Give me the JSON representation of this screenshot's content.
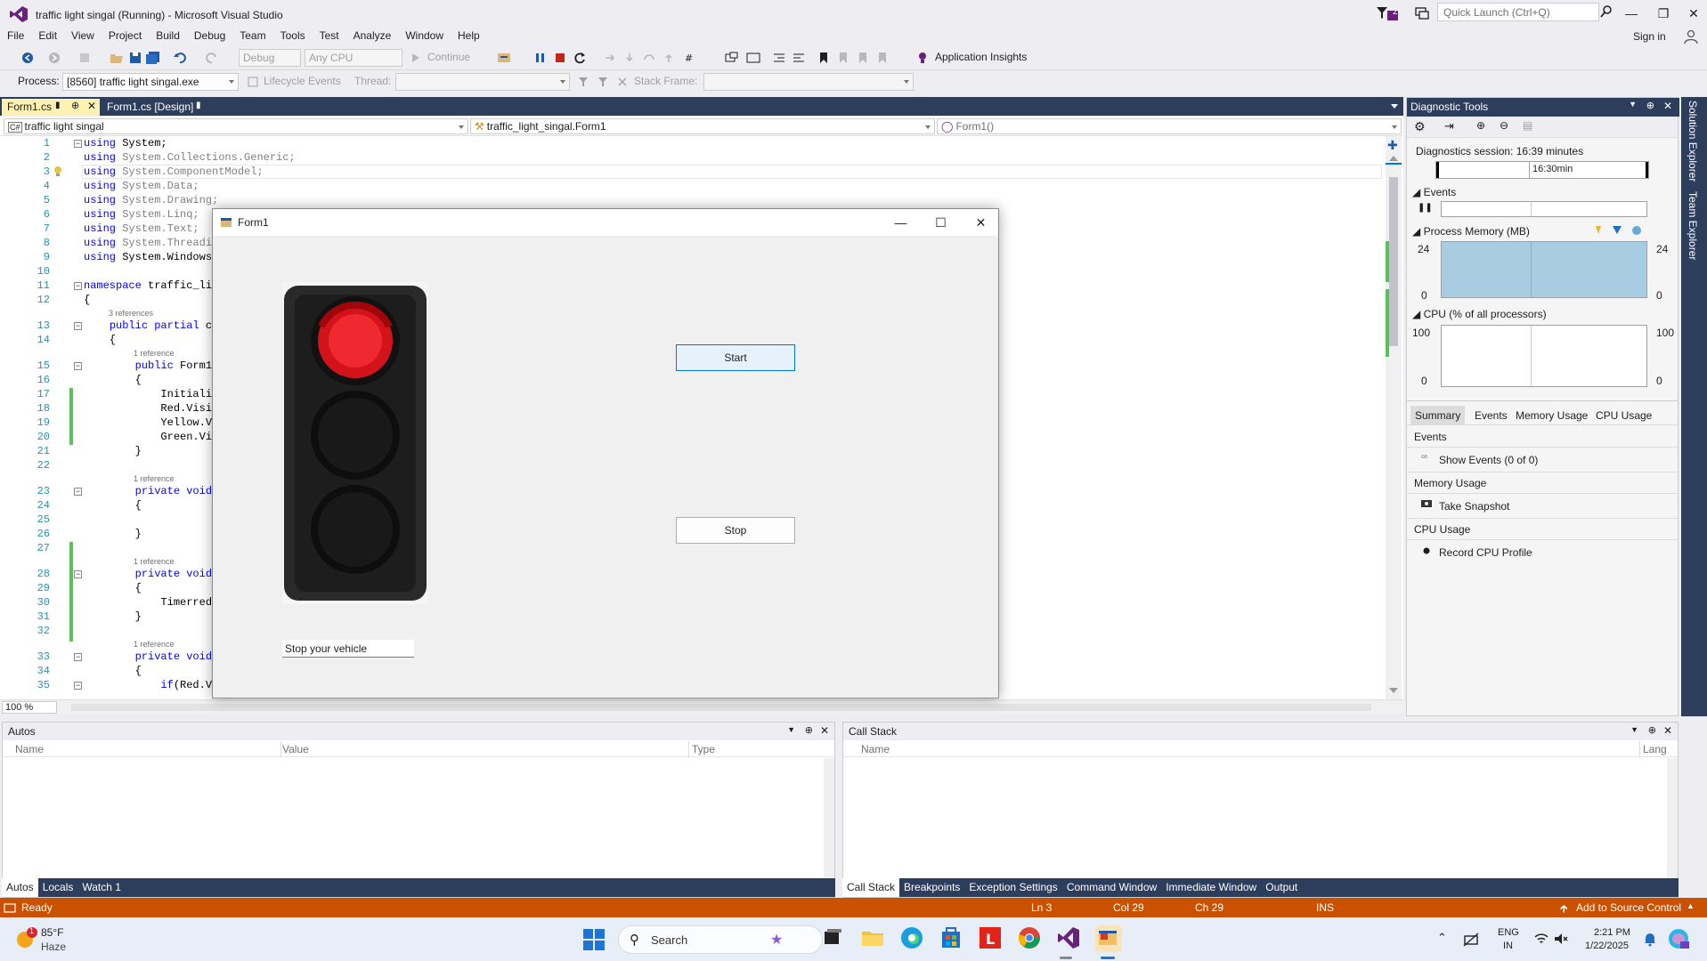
{
  "window": {
    "title": "traffic light singal (Running) - Microsoft Visual Studio",
    "notification_count": "2",
    "quick_launch_placeholder": "Quick Launch (Ctrl+Q)",
    "sign_in": "Sign in"
  },
  "menu": [
    "File",
    "Edit",
    "View",
    "Project",
    "Build",
    "Debug",
    "Team",
    "Tools",
    "Test",
    "Analyze",
    "Window",
    "Help"
  ],
  "toolbar": {
    "config": "Debug",
    "platform": "Any CPU",
    "continue_label": "Continue",
    "app_insights": "Application Insights"
  },
  "debug_location": {
    "process_label": "Process:",
    "process_value": "[8560] traffic light singal.exe",
    "lifecycle_label": "Lifecycle Events",
    "thread_label": "Thread:",
    "stack_frame_label": "Stack Frame:"
  },
  "doc_tabs": [
    {
      "label": "Form1.cs",
      "active": true
    },
    {
      "label": "Form1.cs [Design]",
      "active": false
    }
  ],
  "nav_bar": {
    "project": "traffic light singal",
    "class": "traffic_light_singal.Form1",
    "member": "Form1()"
  },
  "code_lines": [
    {
      "n": "1",
      "t": "using System;"
    },
    {
      "n": "2",
      "t": "using System.Collections.Generic;"
    },
    {
      "n": "3",
      "t": "using System.ComponentModel;"
    },
    {
      "n": "4",
      "t": "using System.Data;"
    },
    {
      "n": "5",
      "t": "using System.Drawing;"
    },
    {
      "n": "6",
      "t": "using System.Linq;"
    },
    {
      "n": "7",
      "t": "using System.Text;"
    },
    {
      "n": "8",
      "t": "using System.Threadir"
    },
    {
      "n": "9",
      "t": "using System.Windows."
    },
    {
      "n": "10",
      "t": ""
    },
    {
      "n": "11",
      "t": "namespace traffic_lig"
    },
    {
      "n": "12",
      "t": "{"
    },
    {
      "n": "13",
      "t": "    public partial cl"
    },
    {
      "n": "14",
      "t": "    {"
    },
    {
      "n": "15",
      "t": "        public Form1("
    },
    {
      "n": "16",
      "t": "        {"
    },
    {
      "n": "17",
      "t": "            Initiali"
    },
    {
      "n": "18",
      "t": "            Red.Visib"
    },
    {
      "n": "19",
      "t": "            Yellow.Vi"
    },
    {
      "n": "20",
      "t": "            Green.Vis"
    },
    {
      "n": "21",
      "t": "        }"
    },
    {
      "n": "22",
      "t": ""
    },
    {
      "n": "23",
      "t": "        private void"
    },
    {
      "n": "24",
      "t": "        {"
    },
    {
      "n": "25",
      "t": ""
    },
    {
      "n": "26",
      "t": "        }"
    },
    {
      "n": "27",
      "t": ""
    },
    {
      "n": "28",
      "t": "        private void"
    },
    {
      "n": "29",
      "t": "        {"
    },
    {
      "n": "30",
      "t": "            Timerred."
    },
    {
      "n": "31",
      "t": "        }"
    },
    {
      "n": "32",
      "t": ""
    },
    {
      "n": "33",
      "t": "        private void"
    },
    {
      "n": "34",
      "t": "        {"
    },
    {
      "n": "35",
      "t": "            if(Red.Vi"
    }
  ],
  "references": {
    "three": "3 references",
    "one": "1 reference"
  },
  "zoom": "100 %",
  "form1": {
    "title": "Form1",
    "start_label": "Start",
    "stop_label": "Stop",
    "textbox_value": "Stop your vehicle"
  },
  "diagnostic": {
    "title": "Diagnostic Tools",
    "session": "Diagnostics session: 16:39 minutes",
    "timeline_label": "16:30min",
    "events_label": "Events",
    "memory_label": "Process Memory (MB)",
    "memory_max": "24",
    "memory_min": "0",
    "cpu_label": "CPU (% of all processors)",
    "cpu_max": "100",
    "cpu_min": "0",
    "tabs": [
      "Summary",
      "Events",
      "Memory Usage",
      "CPU Usage"
    ],
    "sec_events": "Events",
    "show_events": "Show Events (0 of 0)",
    "sec_memory": "Memory Usage",
    "take_snapshot": "Take Snapshot",
    "sec_cpu": "CPU Usage",
    "record_cpu": "Record CPU Profile",
    "memory_fill": 1.0
  },
  "side_tabs": [
    "Solution Explorer",
    "Team Explorer"
  ],
  "autos": {
    "title": "Autos",
    "col_name": "Name",
    "col_value": "Value",
    "col_type": "Type",
    "tabs": [
      "Autos",
      "Locals",
      "Watch 1"
    ]
  },
  "callstack": {
    "title": "Call Stack",
    "col_name": "Name",
    "col_lang": "Lang",
    "tabs": [
      "Call Stack",
      "Breakpoints",
      "Exception Settings",
      "Command Window",
      "Immediate Window",
      "Output"
    ]
  },
  "status": {
    "ready": "Ready",
    "ln": "Ln 3",
    "col": "Col 29",
    "ch": "Ch 29",
    "ins": "INS",
    "source_control": "Add to Source Control"
  },
  "taskbar": {
    "weather_temp": "85°F",
    "weather_desc": "Haze",
    "weather_badge": "1",
    "search_placeholder": "Search",
    "lang1": "ENG",
    "lang2": "IN",
    "time": "2:21 PM",
    "date": "1/22/2025"
  },
  "colors": {
    "accent": "#2d3e5c",
    "status": "#ca5100",
    "start_button": "#e5f1fb"
  }
}
